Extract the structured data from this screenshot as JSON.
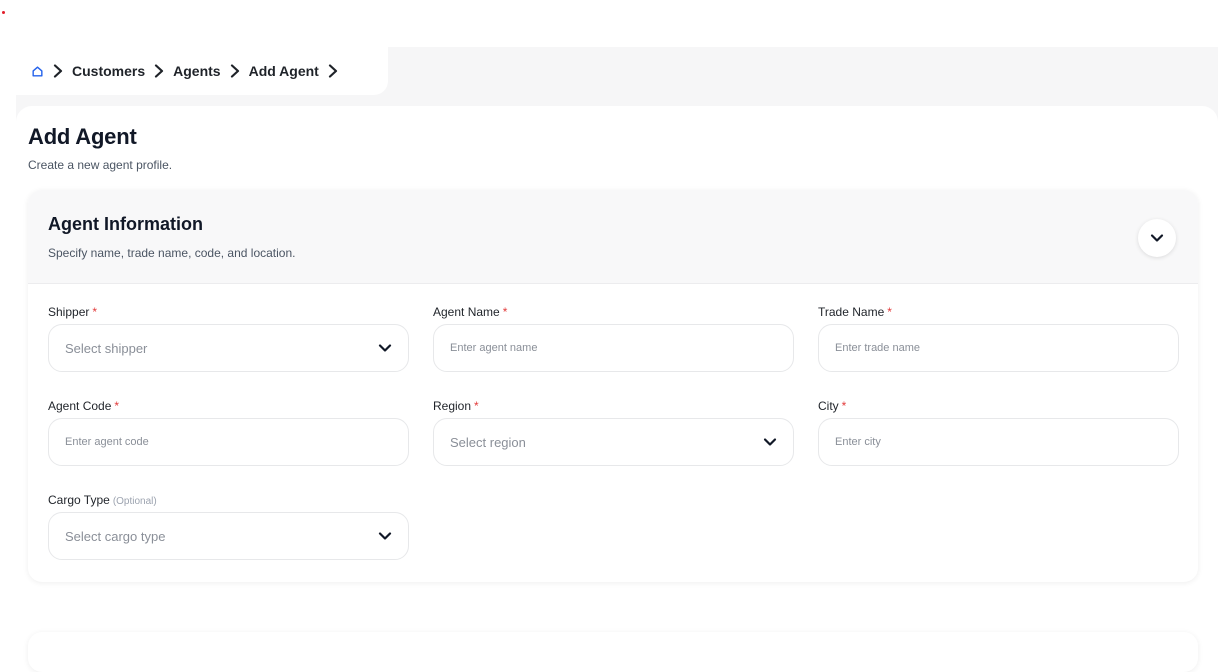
{
  "breadcrumb": {
    "items": [
      "Customers",
      "Agents",
      "Add Agent"
    ]
  },
  "page": {
    "title": "Add Agent",
    "subtitle": "Create a new agent profile."
  },
  "agent_info": {
    "title": "Agent Information",
    "subtitle": "Specify name, trade name, code, and location.",
    "fields": {
      "shipper": {
        "label": "Shipper",
        "required": "*",
        "placeholder": "Select shipper"
      },
      "agent_name": {
        "label": "Agent Name",
        "required": "*",
        "placeholder": "Enter agent name"
      },
      "trade_name": {
        "label": "Trade Name",
        "required": "*",
        "placeholder": "Enter trade name"
      },
      "agent_code": {
        "label": "Agent Code",
        "required": "*",
        "placeholder": "Enter agent code"
      },
      "region": {
        "label": "Region",
        "required": "*",
        "placeholder": "Select region"
      },
      "city": {
        "label": "City",
        "required": "*",
        "placeholder": "Enter city"
      },
      "cargo_type": {
        "label": "Cargo Type",
        "optional": "(Optional)",
        "placeholder": "Select cargo type"
      }
    }
  },
  "colors": {
    "required": "#e23b3b",
    "canvas": "#f6f6f7",
    "text": "#1f2329",
    "muted": "#8a8f98"
  },
  "icons": {
    "home": "home-icon",
    "separator": "chevron-right-icon",
    "collapse": "chevron-down-icon",
    "select": "chevron-down-icon"
  }
}
